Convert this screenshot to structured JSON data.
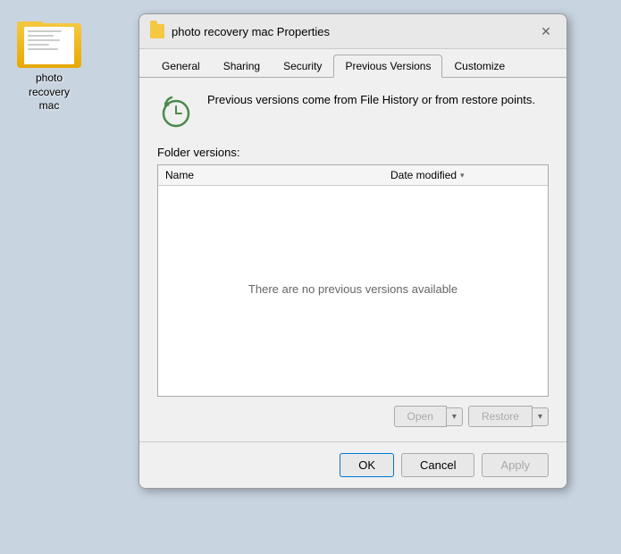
{
  "desktop": {
    "background_color": "#c8d4e0"
  },
  "folder_icon": {
    "label_line1": "photo recovery",
    "label_line2": "mac"
  },
  "dialog": {
    "title": "photo recovery mac Properties",
    "title_icon_alt": "folder-icon",
    "close_label": "✕",
    "tabs": [
      {
        "id": "general",
        "label": "General",
        "active": false
      },
      {
        "id": "sharing",
        "label": "Sharing",
        "active": false
      },
      {
        "id": "security",
        "label": "Security",
        "active": false
      },
      {
        "id": "previous-versions",
        "label": "Previous Versions",
        "active": true
      },
      {
        "id": "customize",
        "label": "Customize",
        "active": false
      }
    ],
    "content": {
      "info_text": "Previous versions come from File History or from restore points.",
      "section_label": "Folder versions:",
      "table": {
        "columns": [
          {
            "id": "name",
            "label": "Name",
            "has_sort": false
          },
          {
            "id": "date_modified",
            "label": "Date modified",
            "has_sort": true
          }
        ],
        "empty_message": "There are no previous versions available"
      },
      "action_buttons": [
        {
          "id": "open",
          "label": "Open",
          "dropdown": true,
          "disabled": true
        },
        {
          "id": "restore",
          "label": "Restore",
          "dropdown": true,
          "disabled": true
        }
      ]
    },
    "footer": {
      "ok_label": "OK",
      "cancel_label": "Cancel",
      "apply_label": "Apply"
    }
  }
}
